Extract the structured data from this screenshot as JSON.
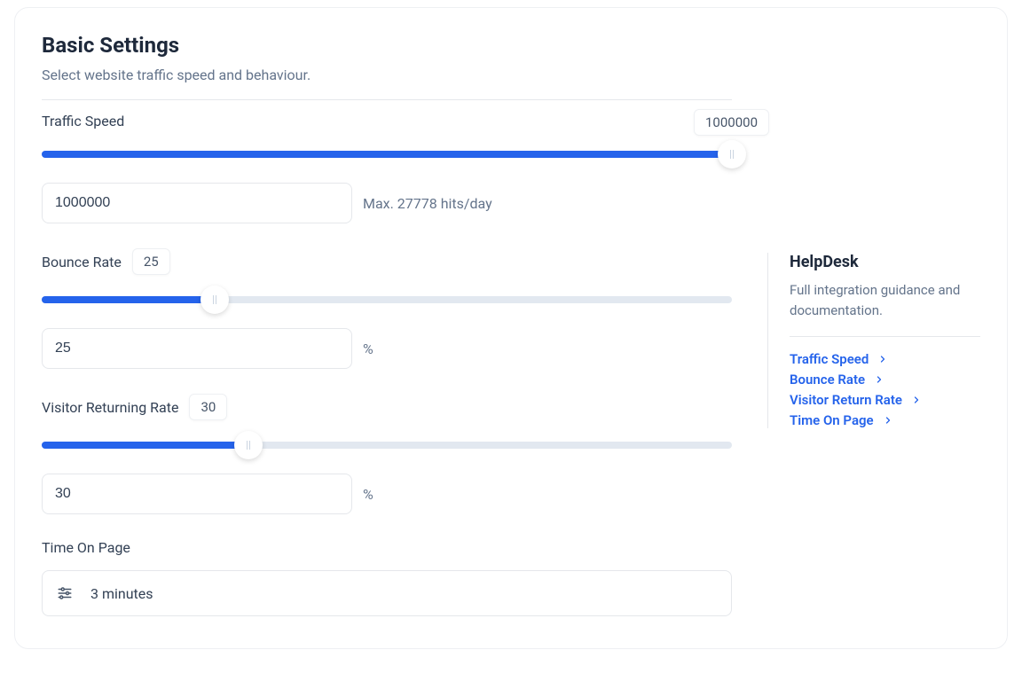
{
  "header": {
    "title": "Basic Settings",
    "subtitle": "Select website traffic speed and behaviour."
  },
  "trafficSpeed": {
    "label": "Traffic Speed",
    "tooltip": "1000000",
    "inputValue": "1000000",
    "hitsText": "Max. 27778 hits/day",
    "percent": 100
  },
  "bounceRate": {
    "label": "Bounce Rate",
    "tooltip": "25",
    "inputValue": "25",
    "suffix": "%",
    "percent": 25
  },
  "visitorReturn": {
    "label": "Visitor Returning Rate",
    "tooltip": "30",
    "inputValue": "30",
    "suffix": "%",
    "percent": 30
  },
  "timeOnPage": {
    "label": "Time On Page",
    "selectValue": "3 minutes"
  },
  "helpdesk": {
    "title": "HelpDesk",
    "desc": "Full integration guidance and documentation.",
    "links": [
      "Traffic Speed",
      "Bounce Rate",
      "Visitor Return Rate",
      "Time On Page"
    ]
  }
}
